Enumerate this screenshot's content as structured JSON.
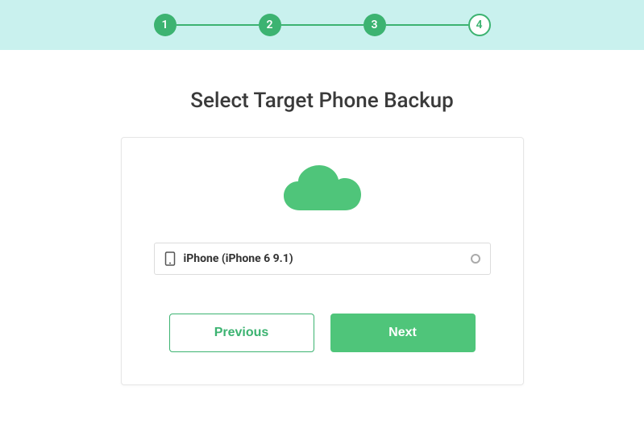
{
  "stepper": {
    "steps": [
      {
        "label": "1",
        "state": "filled"
      },
      {
        "label": "2",
        "state": "filled"
      },
      {
        "label": "3",
        "state": "filled"
      },
      {
        "label": "4",
        "state": "current"
      }
    ]
  },
  "title": "Select Target Phone Backup",
  "device": {
    "label": "iPhone (iPhone 6 9.1)"
  },
  "buttons": {
    "previous": "Previous",
    "next": "Next"
  }
}
